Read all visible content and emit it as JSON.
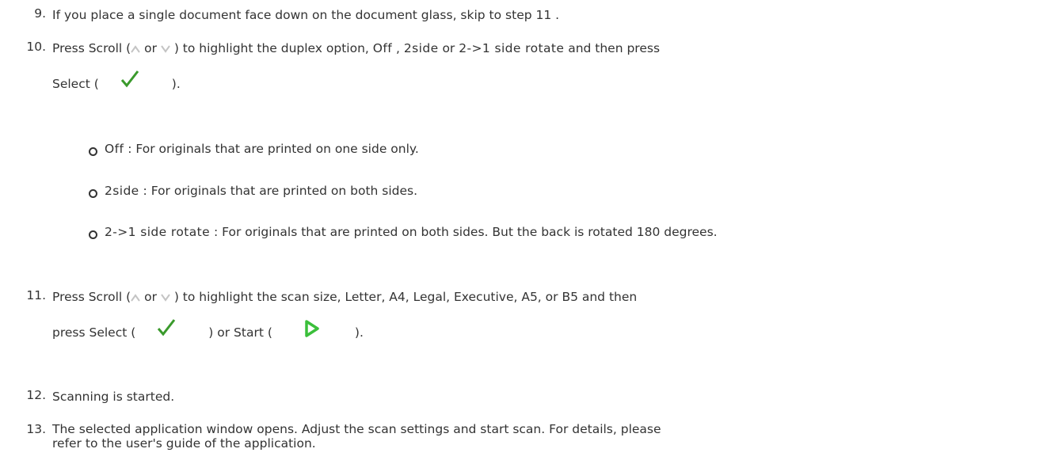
{
  "steps": [
    {
      "num": "9.",
      "text": "If you place a single document face down on the document glass, skip to step 11 ."
    },
    {
      "num": "10.",
      "line1_prefix": "Press Scroll (",
      "line1_or": " or ",
      "line1_mid": " ) to highlight the duplex option, ",
      "opt_off": "Off",
      "sep1": " , ",
      "opt_2side": "2side",
      "sep2": " or ",
      "opt_rotate": "2->1 side rotate",
      "line1_suffix": " and then press",
      "line2_prefix": "Select (",
      "line2_suffix": ")."
    },
    {
      "num": "11.",
      "line1_prefix": "Press Scroll (",
      "line1_or": " or ",
      "line1_suffix": " ) to highlight the scan size, Letter, A4, Legal, Executive, A5, or B5 and then",
      "line2_prefix": "press Select (",
      "line2_mid": ") or Start (",
      "line2_suffix": ")."
    },
    {
      "num": "12.",
      "text": "Scanning is started."
    },
    {
      "num": "13.",
      "line1": "The selected application window opens. Adjust the scan settings and start scan. For details, please",
      "line2": "refer to the user's guide of the application."
    }
  ],
  "options": [
    {
      "term": "Off",
      "desc": " : For originals that are printed on one side only."
    },
    {
      "term": "2side",
      "desc": " : For originals that are printed on both sides."
    },
    {
      "term": "2->1 side rotate",
      "desc": " : For originals that are printed on both sides. But the back is rotated 180 degrees."
    }
  ],
  "icons": {
    "scroll_up": "scroll-up-icon",
    "scroll_down": "scroll-down-icon",
    "select": "checkmark-icon",
    "start": "start-play-icon",
    "start_color": "#3bbf3b",
    "check_color": "#3a9a2c"
  }
}
